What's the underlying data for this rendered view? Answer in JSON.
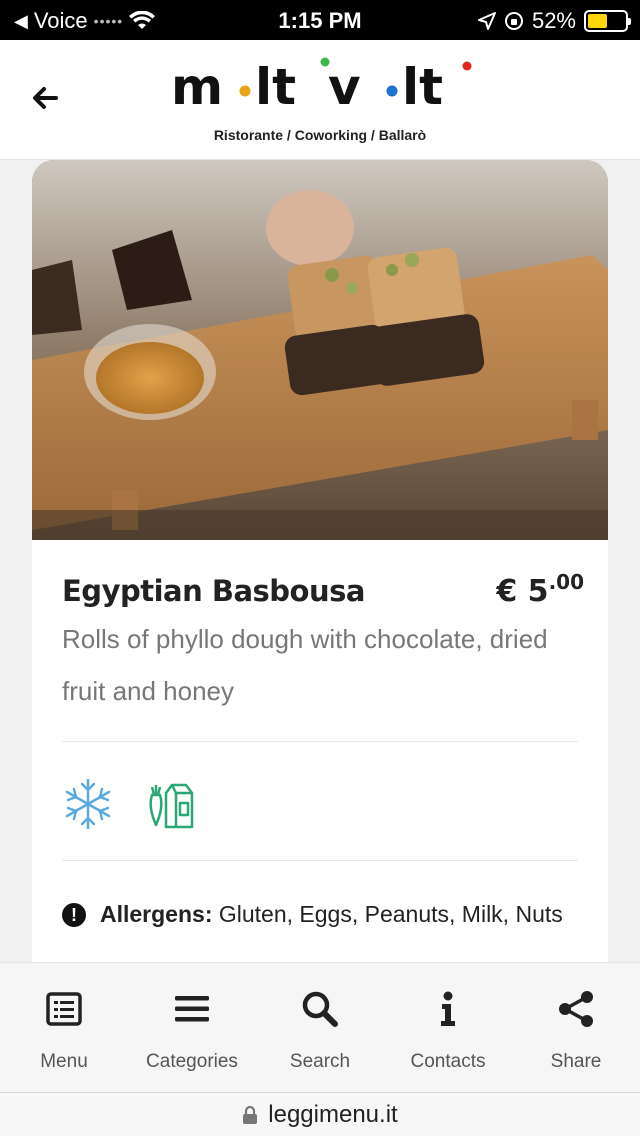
{
  "status_bar": {
    "carrier": "Voice",
    "time": "1:15 PM",
    "battery": "52%",
    "battery_level": 0.52
  },
  "header": {
    "logo_text": "m·lt'v·lt",
    "tagline": "Ristorante / Coworking / Ballarò",
    "logo_colors": [
      "#e8a317",
      "#3db84a",
      "#1f6fd1",
      "#e0251b"
    ]
  },
  "dish": {
    "title": "Egyptian Basbousa",
    "price_main": "€ 5",
    "price_cents": ".00",
    "description": "Rolls of phyllo dough with chocolate, dried fruit and honey",
    "feature_icons": [
      "snowflake-icon",
      "vegetarian-icon"
    ],
    "allergens_label": "Allergens:",
    "allergens_list": "Gluten, Eggs, Peanuts, Milk, Nuts"
  },
  "nav": {
    "items": [
      {
        "label": "Menu",
        "icon": "menu-list-icon"
      },
      {
        "label": "Categories",
        "icon": "hamburger-icon"
      },
      {
        "label": "Search",
        "icon": "search-icon"
      },
      {
        "label": "Contacts",
        "icon": "info-icon"
      },
      {
        "label": "Share",
        "icon": "share-icon"
      }
    ]
  },
  "browser": {
    "url": "leggimenu.it"
  },
  "colors": {
    "snowflake": "#5aa9de",
    "vegetarian": "#2aa776"
  }
}
